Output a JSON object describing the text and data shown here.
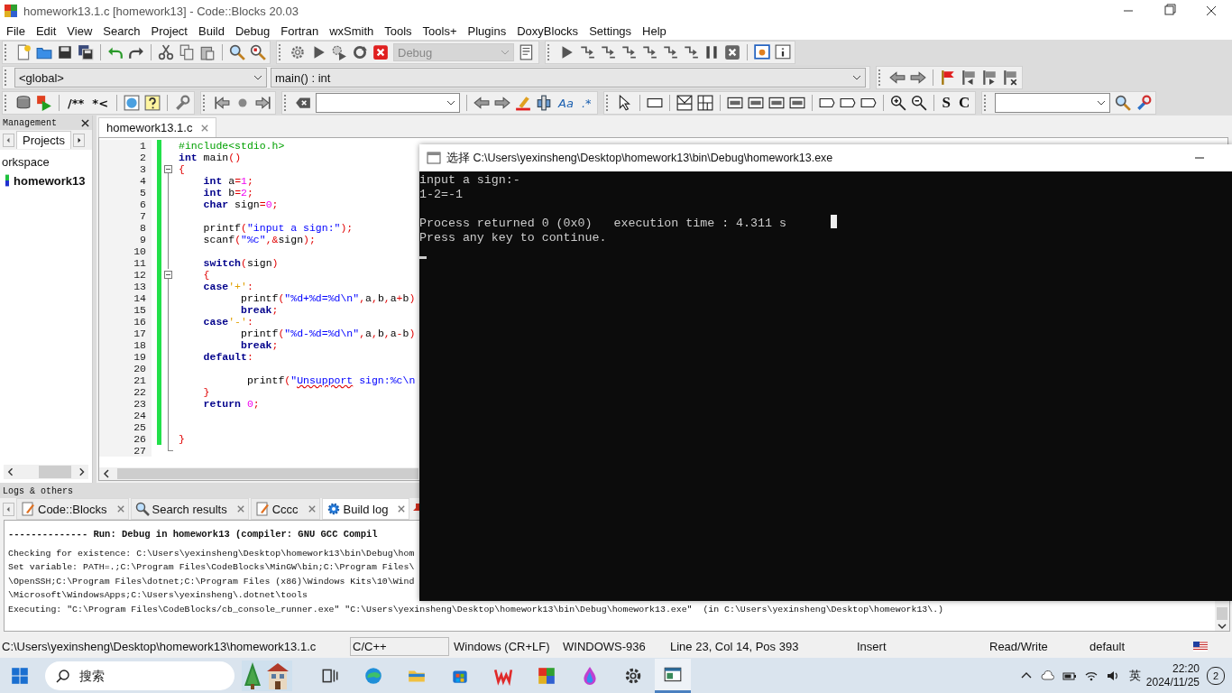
{
  "window": {
    "title": "homework13.1.c [homework13] - Code::Blocks 20.03"
  },
  "menu": [
    "File",
    "Edit",
    "View",
    "Search",
    "Project",
    "Build",
    "Debug",
    "Fortran",
    "wxSmith",
    "Tools",
    "Tools+",
    "Plugins",
    "DoxyBlocks",
    "Settings",
    "Help"
  ],
  "toolbars": {
    "build_target": "Debug",
    "scope": "<global>",
    "function": "main() : int",
    "doc_buttons": [
      "/**",
      "*<"
    ],
    "text_buttons": [
      "Aa",
      ".*"
    ],
    "toggle_buttons": [
      "S",
      "C"
    ]
  },
  "management": {
    "title": "Management",
    "tabs": [
      {
        "label": "Projects",
        "selected": true
      }
    ],
    "tree": [
      {
        "label": "orkspace",
        "children": [
          {
            "label": "homework13"
          }
        ]
      }
    ]
  },
  "editor": {
    "tabs": [
      {
        "label": "homework13.1.c",
        "selected": true
      }
    ],
    "lines": [
      {
        "number": "1",
        "changed": true,
        "fold_point": false,
        "segments": [
          {
            "kind": "preprocessor",
            "text": "#include<stdio.h>"
          }
        ]
      },
      {
        "number": "2",
        "changed": true,
        "fold_point": false,
        "segments": [
          {
            "kind": "keyword",
            "text": "int"
          },
          {
            "kind": "plain",
            "text": " main"
          },
          {
            "kind": "operator",
            "text": "()"
          }
        ]
      },
      {
        "number": "3",
        "changed": true,
        "fold_point": true,
        "segments": [
          {
            "kind": "operator",
            "text": "{"
          }
        ]
      },
      {
        "number": "4",
        "changed": true,
        "fold_point": false,
        "segments": [
          {
            "kind": "keyword",
            "text": "    int"
          },
          {
            "kind": "plain",
            "text": " a"
          },
          {
            "kind": "operator",
            "text": "="
          },
          {
            "kind": "number",
            "text": "1"
          },
          {
            "kind": "operator",
            "text": ";"
          }
        ]
      },
      {
        "number": "5",
        "changed": true,
        "fold_point": false,
        "segments": [
          {
            "kind": "keyword",
            "text": "    int"
          },
          {
            "kind": "plain",
            "text": " b"
          },
          {
            "kind": "operator",
            "text": "="
          },
          {
            "kind": "number",
            "text": "2"
          },
          {
            "kind": "operator",
            "text": ";"
          }
        ]
      },
      {
        "number": "6",
        "changed": true,
        "fold_point": false,
        "segments": [
          {
            "kind": "keyword",
            "text": "    char"
          },
          {
            "kind": "plain",
            "text": " sign"
          },
          {
            "kind": "operator",
            "text": "="
          },
          {
            "kind": "number",
            "text": "0"
          },
          {
            "kind": "operator",
            "text": ";"
          }
        ]
      },
      {
        "number": "7",
        "changed": true,
        "fold_point": false
      },
      {
        "number": "8",
        "changed": true,
        "fold_point": false,
        "segments": [
          {
            "kind": "plain",
            "text": "    printf"
          },
          {
            "kind": "operator",
            "text": "("
          },
          {
            "kind": "string",
            "text": "\"input a sign:\""
          },
          {
            "kind": "operator",
            "text": ");"
          }
        ]
      },
      {
        "number": "9",
        "changed": true,
        "fold_point": false,
        "segments": [
          {
            "kind": "plain",
            "text": "    scanf"
          },
          {
            "kind": "operator",
            "text": "("
          },
          {
            "kind": "string",
            "text": "\"%c\""
          },
          {
            "kind": "operator",
            "text": ",&"
          },
          {
            "kind": "plain",
            "text": "sign"
          },
          {
            "kind": "operator",
            "text": ");"
          }
        ]
      },
      {
        "number": "10",
        "changed": true,
        "fold_point": false
      },
      {
        "number": "11",
        "changed": true,
        "fold_point": false,
        "segments": [
          {
            "kind": "keyword",
            "text": "    switch"
          },
          {
            "kind": "operator",
            "text": "("
          },
          {
            "kind": "plain",
            "text": "sign"
          },
          {
            "kind": "operator",
            "text": ")"
          }
        ]
      },
      {
        "number": "12",
        "changed": true,
        "fold_point": true,
        "segments": [
          {
            "kind": "operator",
            "text": "    {"
          }
        ]
      },
      {
        "number": "13",
        "changed": true,
        "fold_point": false,
        "segments": [
          {
            "kind": "keyword",
            "text": "    case"
          },
          {
            "kind": "char",
            "text": "'+'"
          },
          {
            "kind": "operator",
            "text": ":"
          }
        ]
      },
      {
        "number": "14",
        "changed": true,
        "fold_point": false,
        "segments": [
          {
            "kind": "plain",
            "text": "          printf"
          },
          {
            "kind": "operator",
            "text": "("
          },
          {
            "kind": "string",
            "text": "\"%d+%d=%d\\n\""
          },
          {
            "kind": "operator",
            "text": ","
          },
          {
            "kind": "plain",
            "text": "a"
          },
          {
            "kind": "operator",
            "text": ","
          },
          {
            "kind": "plain",
            "text": "b"
          },
          {
            "kind": "operator",
            "text": ","
          },
          {
            "kind": "plain",
            "text": "a"
          },
          {
            "kind": "operator",
            "text": "+"
          },
          {
            "kind": "plain",
            "text": "b"
          },
          {
            "kind": "operator",
            "text": ")"
          }
        ]
      },
      {
        "number": "15",
        "changed": true,
        "fold_point": false,
        "segments": [
          {
            "kind": "keyword",
            "text": "          break"
          },
          {
            "kind": "operator",
            "text": ";"
          }
        ]
      },
      {
        "number": "16",
        "changed": true,
        "fold_point": false,
        "segments": [
          {
            "kind": "keyword",
            "text": "    case"
          },
          {
            "kind": "char",
            "text": "'-'"
          },
          {
            "kind": "operator",
            "text": ":"
          }
        ]
      },
      {
        "number": "17",
        "changed": true,
        "fold_point": false,
        "segments": [
          {
            "kind": "plain",
            "text": "          printf"
          },
          {
            "kind": "operator",
            "text": "("
          },
          {
            "kind": "string",
            "text": "\"%d-%d=%d\\n\""
          },
          {
            "kind": "operator",
            "text": ","
          },
          {
            "kind": "plain",
            "text": "a"
          },
          {
            "kind": "operator",
            "text": ","
          },
          {
            "kind": "plain",
            "text": "b"
          },
          {
            "kind": "operator",
            "text": ","
          },
          {
            "kind": "plain",
            "text": "a"
          },
          {
            "kind": "operator",
            "text": "-"
          },
          {
            "kind": "plain",
            "text": "b"
          },
          {
            "kind": "operator",
            "text": ")"
          }
        ]
      },
      {
        "number": "18",
        "changed": true,
        "fold_point": false,
        "segments": [
          {
            "kind": "keyword",
            "text": "          break"
          },
          {
            "kind": "operator",
            "text": ";"
          }
        ]
      },
      {
        "number": "19",
        "changed": true,
        "fold_point": false,
        "segments": [
          {
            "kind": "keyword",
            "text": "    default"
          },
          {
            "kind": "operator",
            "text": ":"
          }
        ]
      },
      {
        "number": "20",
        "changed": true,
        "fold_point": false
      },
      {
        "number": "21",
        "changed": true,
        "fold_point": false,
        "segments": [
          {
            "kind": "plain",
            "text": "           printf"
          },
          {
            "kind": "operator",
            "text": "("
          },
          {
            "kind": "string",
            "text": "\""
          },
          {
            "kind": "misspelled",
            "text": "Unsupport"
          },
          {
            "kind": "string",
            "text": " sign:%c\\n"
          }
        ]
      },
      {
        "number": "22",
        "changed": true,
        "fold_point": false,
        "segments": [
          {
            "kind": "operator",
            "text": "    }"
          }
        ]
      },
      {
        "number": "23",
        "changed": true,
        "fold_point": false,
        "segments": [
          {
            "kind": "keyword",
            "text": "    return"
          },
          {
            "kind": "number",
            "text": " 0"
          },
          {
            "kind": "operator",
            "text": ";"
          }
        ]
      },
      {
        "number": "24",
        "changed": true,
        "fold_point": false
      },
      {
        "number": "25",
        "changed": true,
        "fold_point": false
      },
      {
        "number": "26",
        "changed": true,
        "fold_point": false,
        "segments": [
          {
            "kind": "operator",
            "text": "}"
          }
        ]
      },
      {
        "number": "27",
        "changed": false,
        "fold_point": false
      }
    ]
  },
  "logs": {
    "title": "Logs & others",
    "tabs": [
      {
        "label": "Code::Blocks",
        "kind": "log",
        "selected": false
      },
      {
        "label": "Search results",
        "kind": "search",
        "selected": false
      },
      {
        "label": "Cccc",
        "kind": "log",
        "selected": false
      },
      {
        "label": "Build log",
        "kind": "build",
        "selected": true
      }
    ],
    "lines": [
      {
        "kind": "heading",
        "text": "-------------- Run: Debug in homework13 (compiler: GNU GCC Compil"
      },
      {
        "kind": "plain",
        "text": "Checking for existence: C:\\Users\\yexinsheng\\Desktop\\homework13\\bin\\Debug\\hom"
      },
      {
        "kind": "plain",
        "text": "Set variable: PATH=.;C:\\Program Files\\CodeBlocks\\MinGW\\bin;C:\\Program Files\\"
      },
      {
        "kind": "plain",
        "text": "\\OpenSSH;C:\\Program Files\\dotnet;C:\\Program Files (x86)\\Windows Kits\\10\\Wind"
      },
      {
        "kind": "plain",
        "text": "\\Microsoft\\WindowsApps;C:\\Users\\yexinsheng\\.dotnet\\tools"
      },
      {
        "kind": "plain",
        "text": "Executing: \"C:\\Program Files\\CodeBlocks/cb_console_runner.exe\" \"C:\\Users\\yexinsheng\\Desktop\\homework13\\bin\\Debug\\homework13.exe\"  (in C:\\Users\\yexinsheng\\Desktop\\homework13\\.)"
      }
    ]
  },
  "status_bar": [
    "C:\\Users\\yexinsheng\\Desktop\\homework13\\homework13.1.c",
    "C/C++",
    "Windows (CR+LF)",
    "WINDOWS-936",
    "Line 23, Col 14, Pos 393",
    "Insert",
    "Read/Write",
    "default"
  ],
  "console": {
    "title": "选择 C:\\Users\\yexinsheng\\Desktop\\homework13\\bin\\Debug\\homework13.exe",
    "output": [
      "input a sign:-",
      "1-2=-1"
    ],
    "summary": [
      "Process returned 0 (0x0)   execution time : 4.311 s",
      "Press any key to continue."
    ]
  },
  "taskbar": {
    "search_placeholder": "搜索",
    "ime": "英",
    "time": "22:20",
    "date": "2024/11/25",
    "notifications": "2"
  }
}
